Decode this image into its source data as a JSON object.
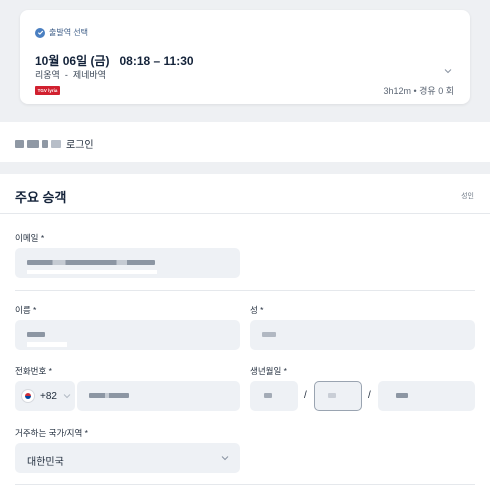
{
  "trip": {
    "tag": "출발역 선택",
    "date_time": "10월 06일 (금)   08:18 – 11:30",
    "route": "리옹역  -  제네바역",
    "operator_logo": "TGV lyria",
    "meta": "3h12m • 경유 0 회"
  },
  "login": {
    "text": "로그인"
  },
  "passenger": {
    "title": "주요 승객",
    "type": "성인",
    "email_label": "이메일 *",
    "first_name_label": "이름 *",
    "last_name_label": "성 *",
    "phone_label": "전화번호 *",
    "country_code": "+82",
    "birth_label": "생년월일 *",
    "birth_sep": "/",
    "residence_label": "거주하는 국가/지역 *",
    "residence_value": "대한민국"
  },
  "colors": {
    "accent": "#4a7fc1",
    "operator": "#d1202f",
    "field_bg": "#eef1f5"
  }
}
